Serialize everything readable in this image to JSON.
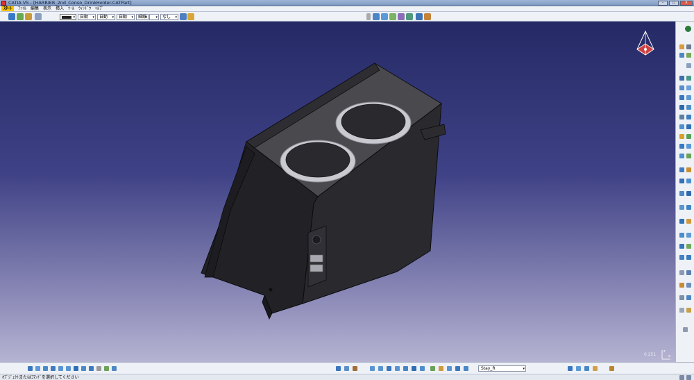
{
  "window": {
    "title": "CATIA V5 - [HARRIER_2nd_Conso_DrinkHolder.CATPart]",
    "buttons": {
      "minimize": "–",
      "maximize": "□",
      "close": "X"
    }
  },
  "menubar": {
    "items": [
      "ｽﾀｰﾄ",
      "ﾌｧｲﾙ",
      "編集",
      "表示",
      "挿入",
      "ﾂｰﾙ",
      "ｳｨﾝﾄﾞｳ",
      "ﾍﾙﾌﾟ"
    ]
  },
  "properties_toolbar": {
    "color": "#222222",
    "combos": [
      "自動",
      "自動",
      "自動",
      "細線",
      "",
      "なし"
    ]
  },
  "viewport": {
    "zoom_readout": "0.251",
    "axis_labels": {
      "z": "z",
      "x": "x"
    }
  },
  "bottom_toolbar": {
    "layer_value": "Stay_R"
  },
  "statusbar": {
    "message": "ｵﾌﾞｼﾞｪｸﾄまたはｺﾏﾝﾄﾞを選択してください"
  },
  "icons": {
    "app": "catia-app-icon",
    "compass": "3d-compass-icon",
    "colors": {
      "toolbar_bg": "#eef1f6",
      "accent_yellow": "#f5c400",
      "viewport_top": "#252a66",
      "viewport_bottom": "#b6b4d2"
    }
  }
}
